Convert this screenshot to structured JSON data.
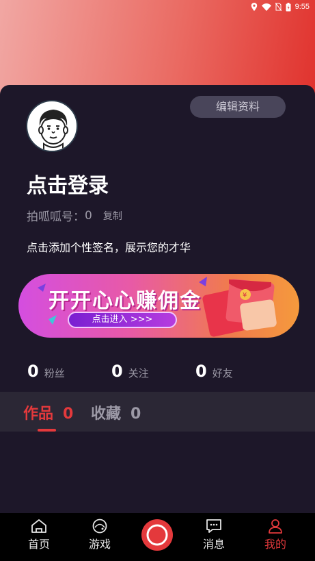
{
  "status_bar": {
    "time": "9:55"
  },
  "profile": {
    "edit_label": "编辑资料",
    "login_text": "点击登录",
    "id_label": "拍呱呱号：",
    "id_value": "0",
    "copy_label": "复制",
    "signature": "点击添加个性签名，展示您的才华"
  },
  "banner": {
    "title": "开开心心赚佣金",
    "button_label": "点击进入 >>>",
    "coin_symbol": "¥"
  },
  "stats": [
    {
      "value": "0",
      "label": "粉丝"
    },
    {
      "value": "0",
      "label": "关注"
    },
    {
      "value": "0",
      "label": "好友"
    }
  ],
  "tabs": [
    {
      "label": "作品",
      "count": "0"
    },
    {
      "label": "收藏",
      "count": "0"
    }
  ],
  "bottom_nav": [
    {
      "label": "首页",
      "icon": "home-icon"
    },
    {
      "label": "游戏",
      "icon": "game-icon"
    },
    {
      "label": "",
      "icon": "record-icon"
    },
    {
      "label": "消息",
      "icon": "message-icon"
    },
    {
      "label": "我的",
      "icon": "profile-icon"
    }
  ],
  "colors": {
    "accent": "#e4393c",
    "background": "#1d1729",
    "tab_bar": "#2b2735"
  }
}
